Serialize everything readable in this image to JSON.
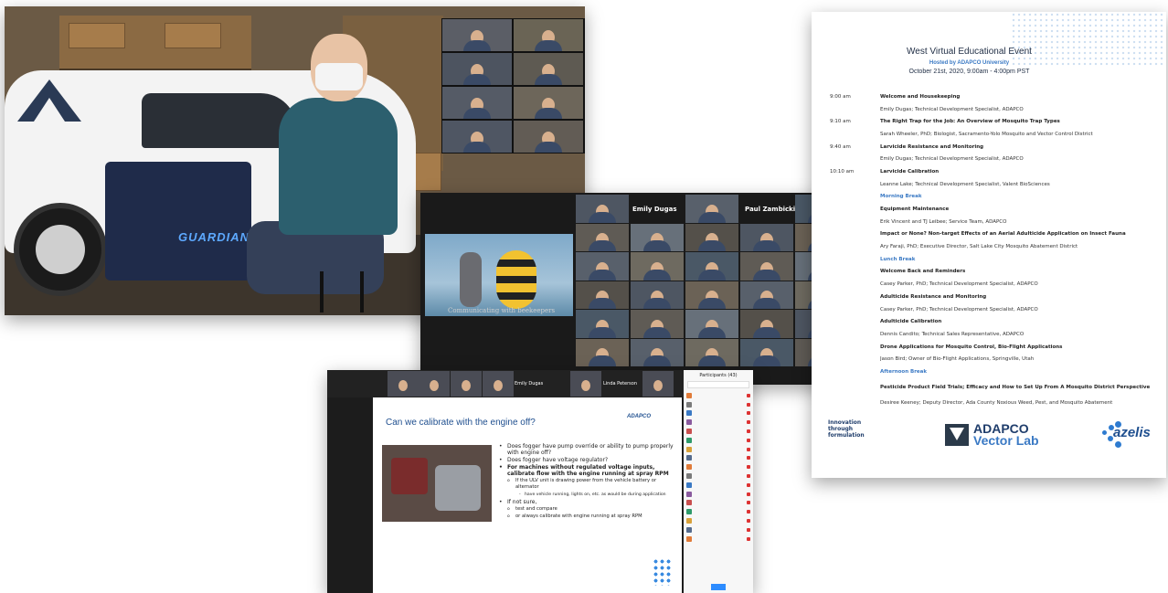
{
  "gallery_video": {
    "thumbnail_names": [
      "",
      "",
      "",
      "",
      "",
      "",
      "",
      ""
    ],
    "logo_text": "GUARDIAN"
  },
  "zoom_gallery": {
    "caption": "Communicating with beekeepers",
    "header_names": [
      "Emily Dugas",
      "Paul Zambicki"
    ]
  },
  "schedule": {
    "title": "West Virtual Educational Event",
    "host": "Hosted by ADAPCO University",
    "date": "October 21st, 2020, 9:00am - 4:00pm PST",
    "rows": [
      {
        "time": "9:00 am",
        "text": "Welcome and Housekeeping",
        "kind": "head"
      },
      {
        "time": "",
        "text": "Emily Dugas; Technical Development Specialist, ADAPCO",
        "kind": "normal"
      },
      {
        "time": "9:10 am",
        "text": "The Right Trap for the Job: An Overview of Mosquito Trap Types",
        "kind": "head"
      },
      {
        "time": "",
        "text": "Sarah Wheeler, PhD; Biologist, Sacramento-Yolo Mosquito and Vector Control District",
        "kind": "normal"
      },
      {
        "time": "9:40 am",
        "text": "Larvicide Resistance and Monitoring",
        "kind": "head"
      },
      {
        "time": "",
        "text": "Emily Dugas; Technical Development Specialist, ADAPCO",
        "kind": "normal"
      },
      {
        "time": "10:10 am",
        "text": "Larvicide Calibration",
        "kind": "head"
      },
      {
        "time": "",
        "text": "Leanne Lake; Technical Development Specialist, Valent BioSciences",
        "kind": "normal"
      },
      {
        "time": "",
        "text": "Morning Break",
        "kind": "break"
      },
      {
        "time": "",
        "text": "Equipment Maintenance",
        "kind": "head"
      },
      {
        "time": "",
        "text": "Erik Vincent and TJ Leibee; Service Team, ADAPCO",
        "kind": "normal"
      },
      {
        "time": "",
        "text": "Impact or None? Non-target Effects of an Aerial Adulticide Application on Insect Fauna",
        "kind": "head"
      },
      {
        "time": "",
        "text": "Ary Faraji, PhD; Executive Director, Salt Lake City Mosquito Abatement District",
        "kind": "normal"
      },
      {
        "time": "",
        "text": "Lunch Break",
        "kind": "break"
      },
      {
        "time": "",
        "text": "Welcome Back and Reminders",
        "kind": "head"
      },
      {
        "time": "",
        "text": "Casey Parker, PhD; Technical Development Specialist, ADAPCO",
        "kind": "normal"
      },
      {
        "time": "",
        "text": "Adulticide Resistance and Monitoring",
        "kind": "head"
      },
      {
        "time": "",
        "text": "Casey Parker, PhD; Technical Development Specialist, ADAPCO",
        "kind": "normal"
      },
      {
        "time": "",
        "text": "Adulticide Calibration",
        "kind": "head"
      },
      {
        "time": "",
        "text": "Dennis Candito; Technical Sales Representative, ADAPCO",
        "kind": "normal"
      },
      {
        "time": "",
        "text": "Drone Applications for Mosquito Control, Bio-Flight Applications",
        "kind": "head"
      },
      {
        "time": "",
        "text": "Jason Bird; Owner of Bio-Flight Applications, Springville, Utah",
        "kind": "normal"
      },
      {
        "time": "",
        "text": "Afternoon Break",
        "kind": "break"
      },
      {
        "time": "",
        "text": "Pesticide Product Field Trials; Efficacy and How to Set Up From A Mosquito District Perspective",
        "kind": "head tall"
      },
      {
        "time": "",
        "text": "Desiree Keeney; Deputy Director, Ada County Noxious Weed, Pest, and Mosquito Abatement",
        "kind": "normal"
      }
    ],
    "footer": {
      "tagline_1": "Innovation",
      "tagline_2": "through",
      "tagline_3": "formulation",
      "url": "",
      "brand_1": "ADAPCO",
      "brand_2": "Vector Lab",
      "brand_3": "azelis"
    }
  },
  "slide_share": {
    "top_names": [
      "Emily Dugas",
      "Linda Peterson"
    ],
    "slide_title": "Can we calibrate with the engine off?",
    "slide_logo": "ADAPCO",
    "bullets": [
      {
        "text": "Does fogger have pump override or ability to pump properly with engine off?",
        "level": "bl"
      },
      {
        "text": "Does fogger have voltage regulator?",
        "level": "bl"
      },
      {
        "text": "For machines without regulated voltage inputs, calibrate flow with the engine running at spray RPM",
        "level": "bl hl"
      },
      {
        "text": "If the ULV unit is drawing power from the vehicle battery or alternator",
        "level": "bl sub"
      },
      {
        "text": "have vehicle running, lights on, etc. as would be during application",
        "level": "bl sub2"
      },
      {
        "text": "If not sure,",
        "level": "bl"
      },
      {
        "text": "test and compare",
        "level": "bl sub"
      },
      {
        "text": "or always calibrate with engine running at spray RPM",
        "level": "bl sub"
      }
    ],
    "participants_title": "Participants (43)",
    "participant_count": 17,
    "left_label": ""
  },
  "colors": {
    "accent_blue": "#3a79c4",
    "brand_navy": "#1f3d6b",
    "record_red": "#c62828"
  }
}
